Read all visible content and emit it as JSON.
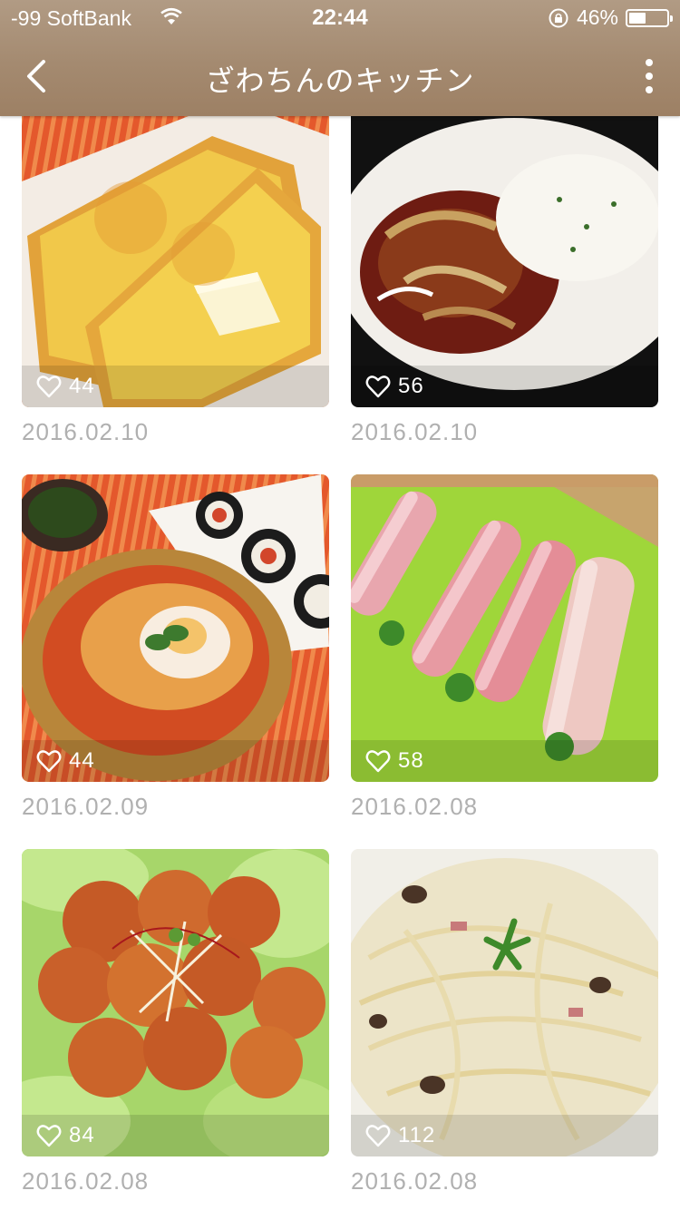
{
  "status": {
    "carrier": "-99 SoftBank",
    "time": "22:44",
    "battery": "46%"
  },
  "nav": {
    "title": "ざわちんのキッチン"
  },
  "cards": [
    {
      "likes": "44",
      "date": "2016.02.10",
      "photo": "french-toast"
    },
    {
      "likes": "56",
      "date": "2016.02.10",
      "photo": "hashed-beef-rice"
    },
    {
      "likes": "44",
      "date": "2016.02.09",
      "photo": "kimchi-stew-and-kimbap"
    },
    {
      "likes": "58",
      "date": "2016.02.08",
      "photo": "prosciutto-rolls"
    },
    {
      "likes": "84",
      "date": "2016.02.08",
      "photo": "chili-chicken"
    },
    {
      "likes": "112",
      "date": "2016.02.08",
      "photo": "cream-pasta"
    }
  ],
  "colors": {
    "header": "#a48a70",
    "date_text": "#b0b0b0"
  }
}
